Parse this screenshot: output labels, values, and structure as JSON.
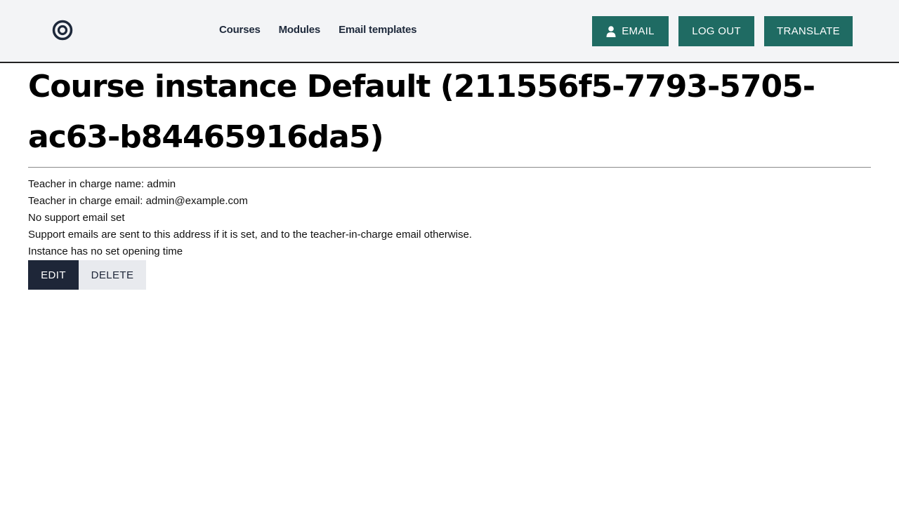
{
  "header": {
    "logo_icon": "target-icon",
    "nav": {
      "courses": "Courses",
      "modules": "Modules",
      "email_templates": "Email templates"
    },
    "buttons": {
      "email": "EMAIL",
      "email_icon": "user-icon",
      "logout": "LOG OUT",
      "translate": "TRANSLATE"
    }
  },
  "main": {
    "title": "Course instance Default (211556f5-7793-5705-ac63-b84465916da5)",
    "info": {
      "teacher_name": "Teacher in charge name: admin",
      "teacher_email": "Teacher in charge email: admin@example.com",
      "support_email": "No support email set",
      "support_note": "Support emails are sent to this address if it is set, and to the teacher-in-charge email otherwise.",
      "opening_time": "Instance has no set opening time"
    },
    "actions": {
      "edit": "EDIT",
      "delete": "DELETE"
    }
  },
  "colors": {
    "nav_background": "#f3f4f6",
    "primary_button": "#1f6b63",
    "edit_button": "#1e2638",
    "delete_button": "#e8eaee"
  }
}
